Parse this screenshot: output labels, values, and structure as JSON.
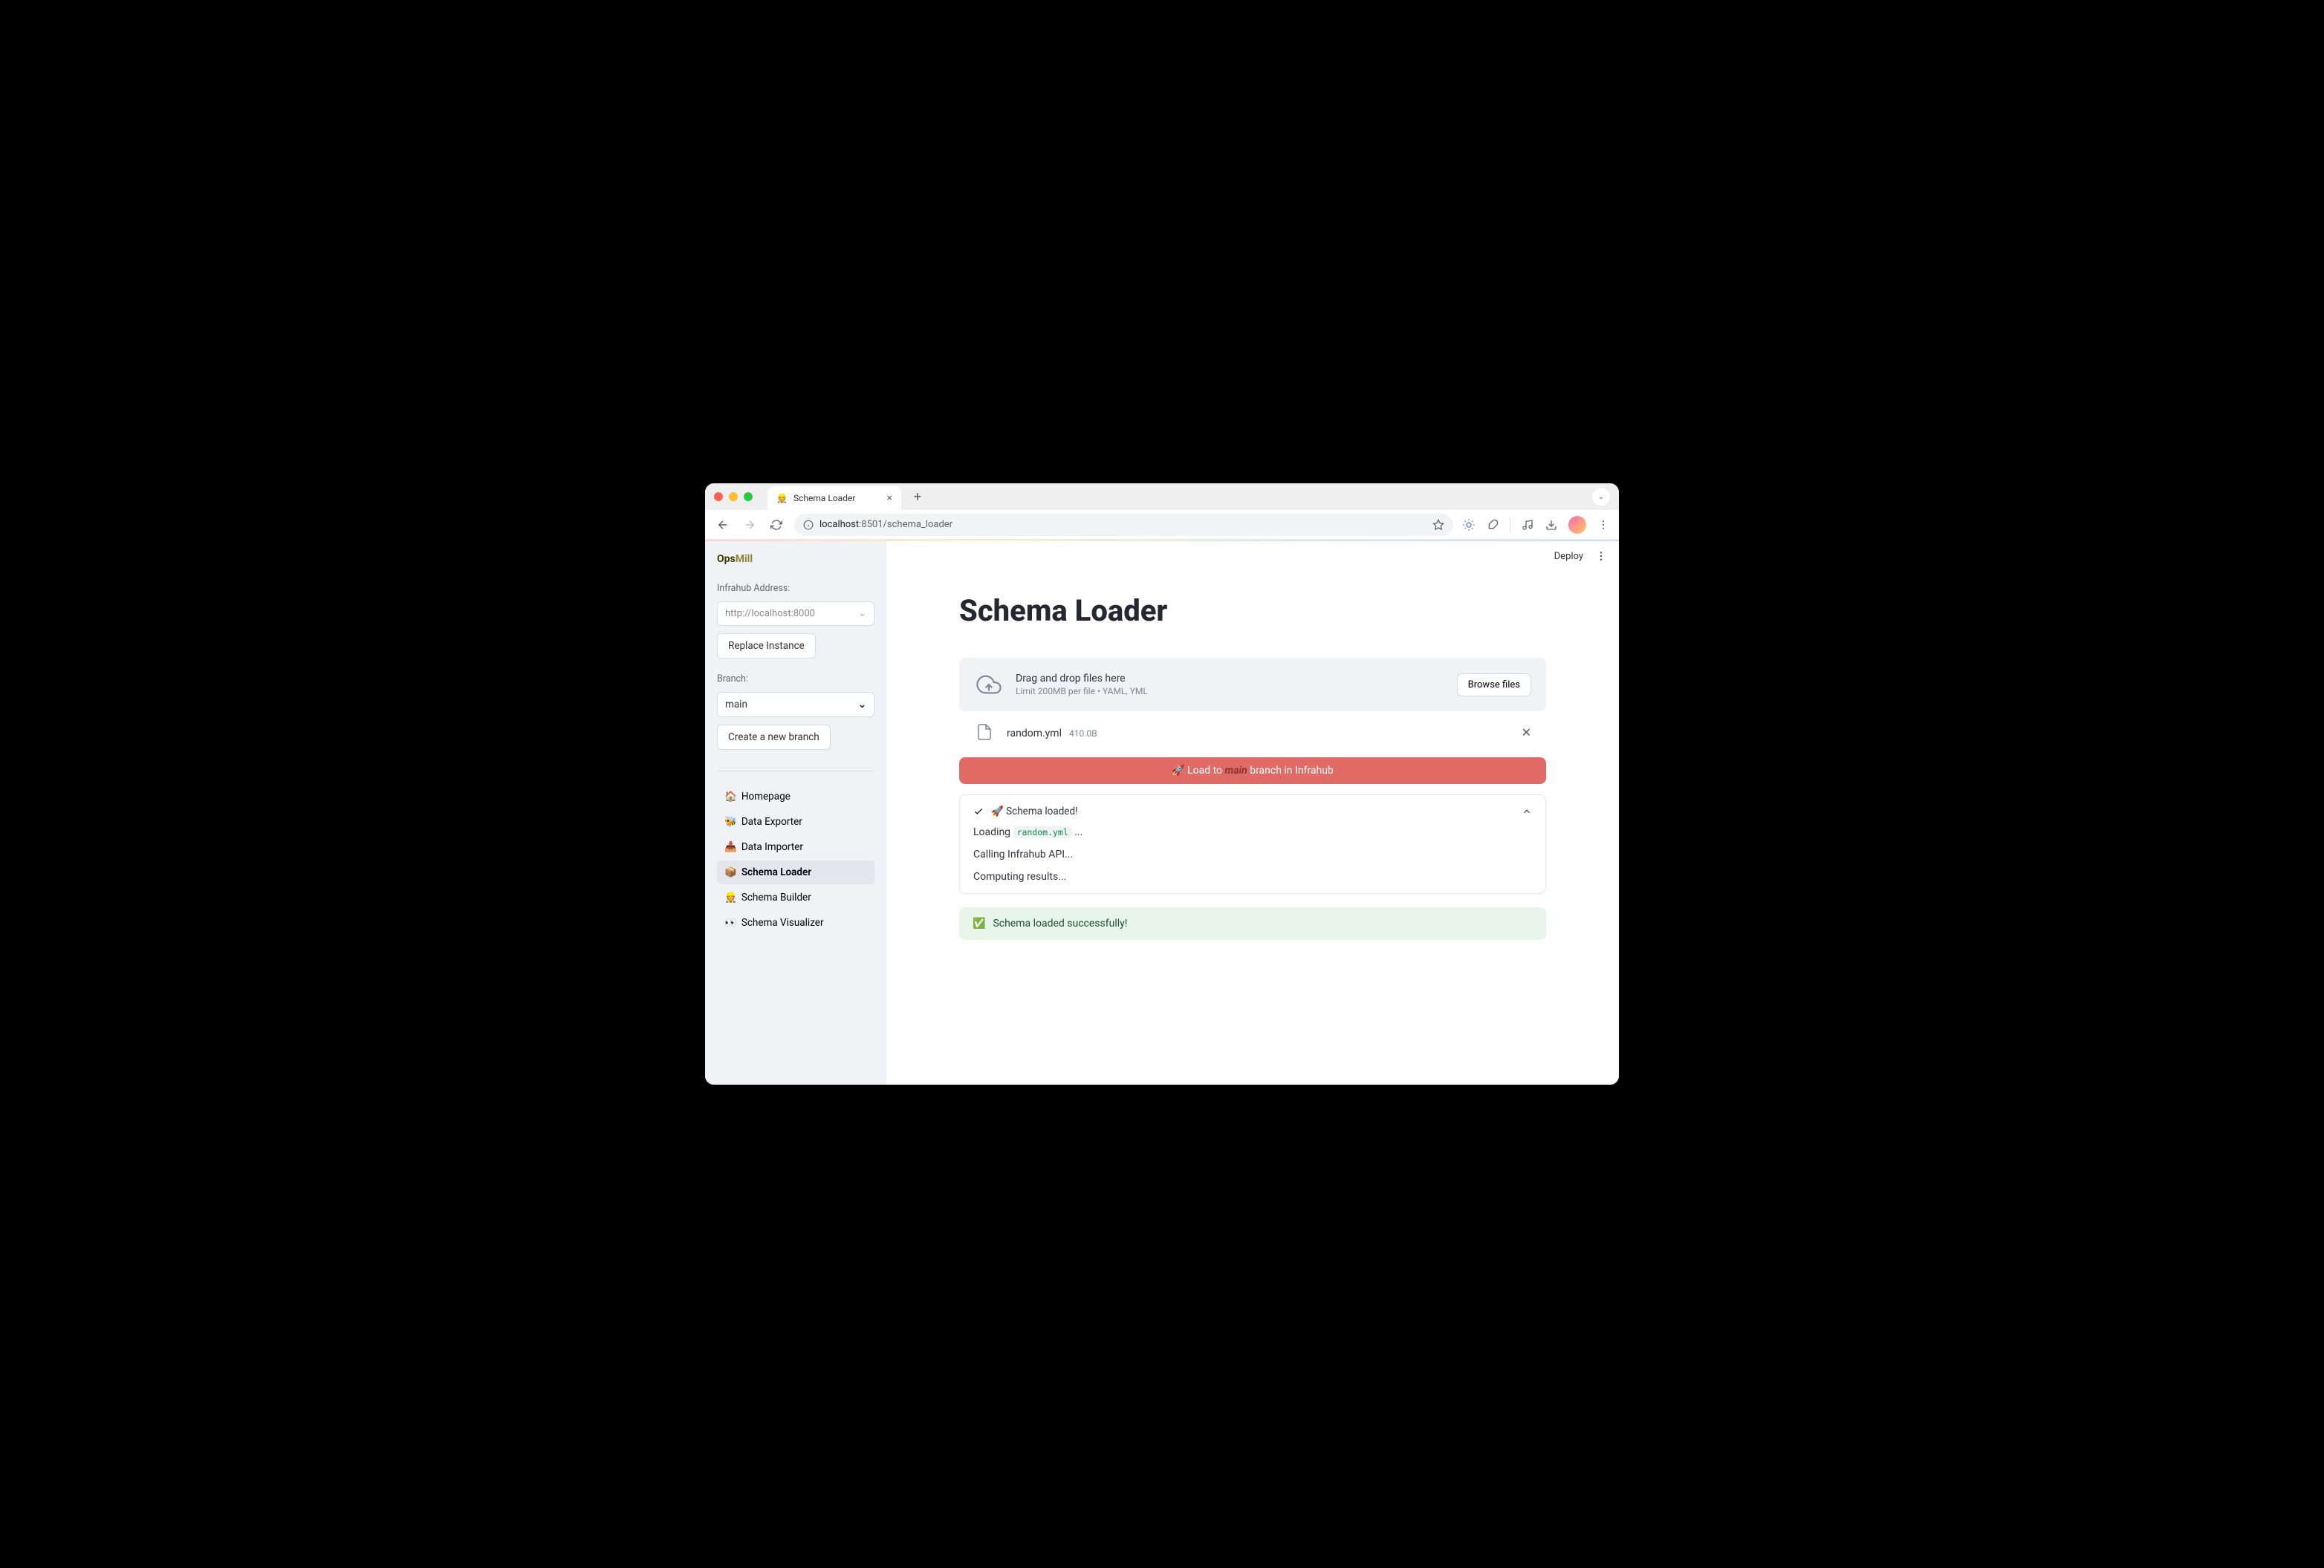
{
  "browser": {
    "tab_title": "Schema Loader",
    "url_host": "localhost",
    "url_port": ":8501",
    "url_path": "/schema_loader"
  },
  "header": {
    "deploy_label": "Deploy"
  },
  "sidebar": {
    "logo_ops": "Ops",
    "logo_mill": "Mill",
    "address_label": "Infrahub Address:",
    "address_placeholder": "http://localhost:8000",
    "replace_instance_label": "Replace Instance",
    "branch_label": "Branch:",
    "branch_value": "main",
    "create_branch_label": "Create a new branch",
    "nav": [
      {
        "icon": "🏠",
        "label": "Homepage"
      },
      {
        "icon": "🐝",
        "label": "Data Exporter"
      },
      {
        "icon": "📥",
        "label": "Data Importer"
      },
      {
        "icon": "📦",
        "label": "Schema Loader"
      },
      {
        "icon": "👷",
        "label": "Schema Builder"
      },
      {
        "icon": "👀",
        "label": "Schema Visualizer"
      }
    ],
    "active_index": 3
  },
  "main": {
    "title": "Schema Loader",
    "dropzone_title": "Drag and drop files here",
    "dropzone_sub": "Limit 200MB per file • YAML, YML",
    "browse_label": "Browse files",
    "file": {
      "name": "random.yml",
      "size": "410.0B"
    },
    "load_prefix": "🚀 Load to ",
    "load_branch": "main",
    "load_suffix": " branch in Infrahub",
    "status_header": "🚀 Schema loaded!",
    "status_loading_prefix": "Loading ",
    "status_loading_file": "random.yml",
    "status_loading_suffix": " ...",
    "status_api": "Calling Infrahub API...",
    "status_compute": "Computing results...",
    "success_icon": "✅",
    "success_text": "Schema loaded successfully!"
  }
}
